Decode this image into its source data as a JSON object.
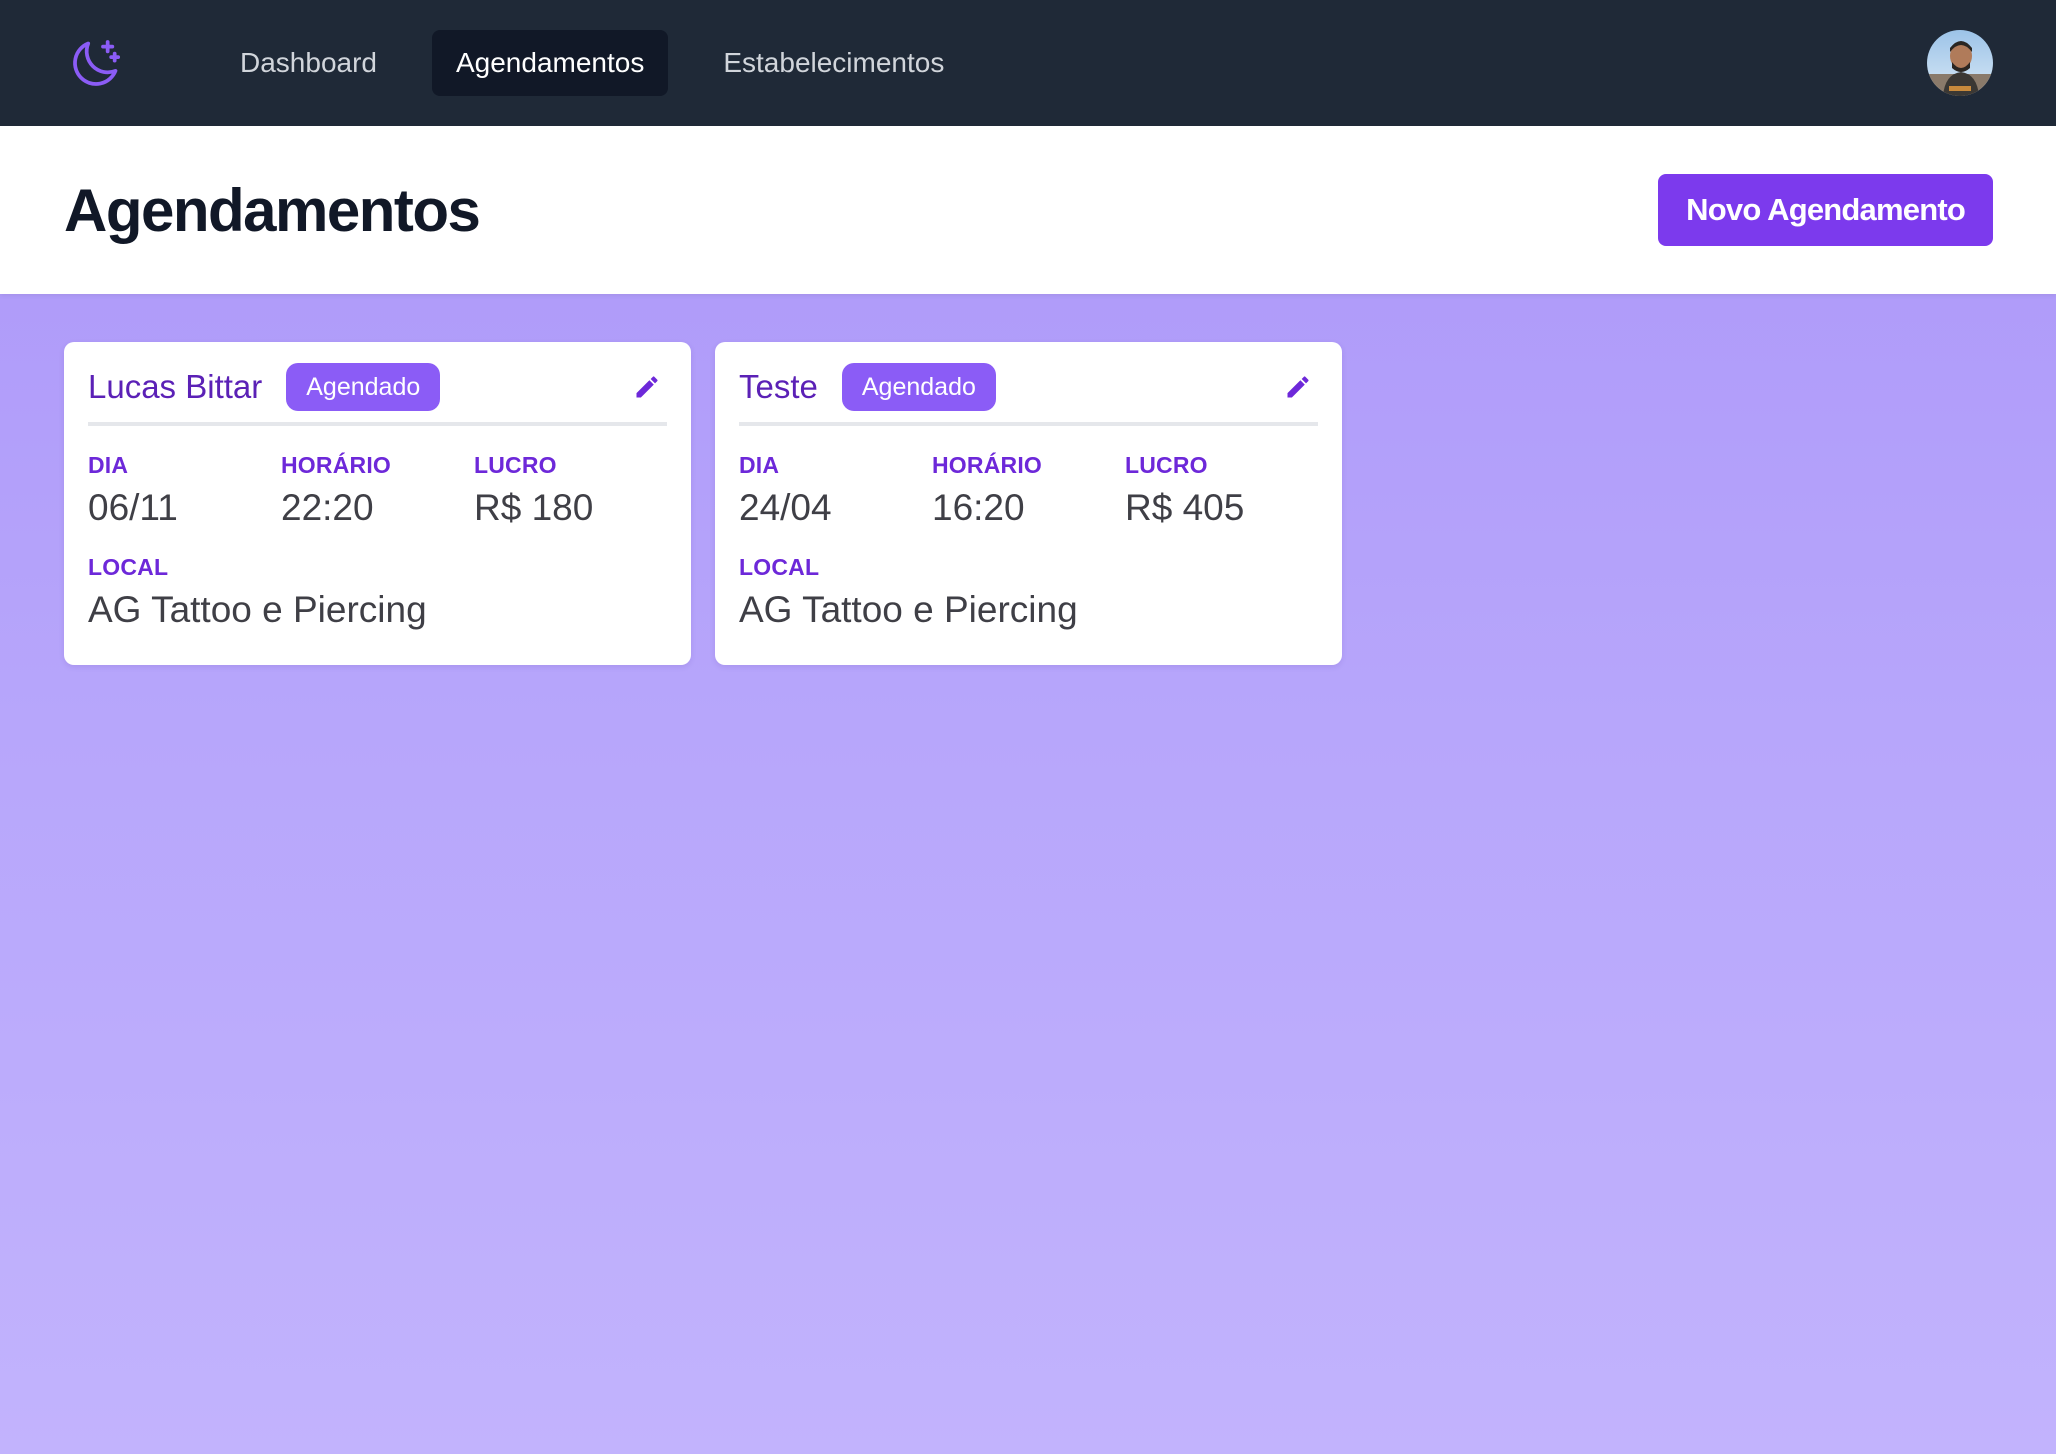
{
  "nav": {
    "logo_icon": "moon-sparkle-icon",
    "links": [
      {
        "label": "Dashboard",
        "active": false
      },
      {
        "label": "Agendamentos",
        "active": true
      },
      {
        "label": "Estabelecimentos",
        "active": false
      }
    ],
    "avatar_icon": "user-avatar"
  },
  "header": {
    "title": "Agendamentos",
    "new_button": "Novo Agendamento"
  },
  "labels": {
    "dia": "DIA",
    "horario": "HORÁRIO",
    "lucro": "LUCRO",
    "local": "LOCAL"
  },
  "appointments": [
    {
      "client": "Lucas Bittar",
      "status": "Agendado",
      "dia": "06/11",
      "horario": "22:20",
      "lucro": "R$ 180",
      "local": "AG Tattoo e Piercing"
    },
    {
      "client": "Teste",
      "status": "Agendado",
      "dia": "24/04",
      "horario": "16:20",
      "lucro": "R$ 405",
      "local": "AG Tattoo e Piercing"
    }
  ],
  "colors": {
    "navbar": "#1f2937",
    "accent": "#7c3aed",
    "badge": "#8b5cf6",
    "label": "#6d28d9"
  }
}
